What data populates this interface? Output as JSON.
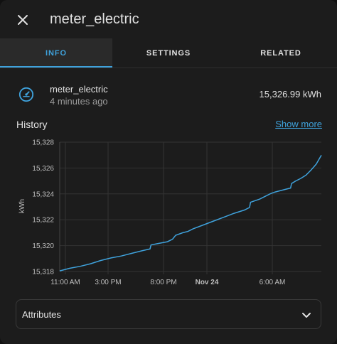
{
  "dialog": {
    "title": "meter_electric"
  },
  "tabs": [
    {
      "label": "INFO",
      "active": true
    },
    {
      "label": "SETTINGS",
      "active": false
    },
    {
      "label": "RELATED",
      "active": false
    }
  ],
  "entity": {
    "name": "meter_electric",
    "last_changed": "4 minutes ago",
    "state": "15,326.99 kWh",
    "icon": "gauge-icon"
  },
  "history": {
    "title": "History",
    "show_more": "Show more"
  },
  "chart_data": {
    "type": "line",
    "ylabel": "kWh",
    "xlabel": "",
    "ylim": [
      15318,
      15328
    ],
    "yticks": [
      15318,
      15320,
      15322,
      15324,
      15326,
      15328
    ],
    "ytick_labels": [
      "15,318",
      "15,320",
      "15,322",
      "15,324",
      "15,326",
      "15,328"
    ],
    "x_range": [
      0,
      24
    ],
    "xticks": [
      0,
      4,
      9,
      13,
      19
    ],
    "xtick_labels": [
      "11:00 AM",
      "3:00 PM",
      "8:00 PM",
      "Nov 24",
      "6:00 AM"
    ],
    "xtick_bold": [
      false,
      false,
      false,
      true,
      false
    ],
    "grid": true,
    "series": [
      {
        "color": "#3fa2dc",
        "points": [
          [
            0.0,
            15318.05
          ],
          [
            1.0,
            15318.25
          ],
          [
            2.0,
            15318.4
          ],
          [
            3.0,
            15318.6
          ],
          [
            4.0,
            15318.85
          ],
          [
            5.0,
            15319.05
          ],
          [
            6.0,
            15319.2
          ],
          [
            7.0,
            15319.4
          ],
          [
            8.0,
            15319.6
          ],
          [
            8.8,
            15319.75
          ],
          [
            8.9,
            15320.05
          ],
          [
            9.5,
            15320.15
          ],
          [
            10.5,
            15320.3
          ],
          [
            11.0,
            15320.5
          ],
          [
            11.3,
            15320.8
          ],
          [
            12.0,
            15321.0
          ],
          [
            12.5,
            15321.1
          ],
          [
            13.0,
            15321.3
          ],
          [
            14.0,
            15321.6
          ],
          [
            15.0,
            15321.9
          ],
          [
            16.0,
            15322.2
          ],
          [
            17.0,
            15322.5
          ],
          [
            18.0,
            15322.75
          ],
          [
            18.5,
            15322.95
          ],
          [
            18.6,
            15323.35
          ],
          [
            19.5,
            15323.6
          ],
          [
            20.0,
            15323.8
          ],
          [
            20.5,
            15324.0
          ],
          [
            21.0,
            15324.15
          ],
          [
            22.0,
            15324.35
          ],
          [
            22.5,
            15324.45
          ],
          [
            22.6,
            15324.8
          ],
          [
            23.0,
            15325.0
          ],
          [
            23.5,
            15325.2
          ],
          [
            24.0,
            15325.45
          ],
          [
            24.5,
            15325.85
          ],
          [
            25.0,
            15326.3
          ],
          [
            25.5,
            15326.99
          ]
        ]
      }
    ]
  },
  "attributes": {
    "label": "Attributes"
  },
  "colors": {
    "accent": "#3fa2dc",
    "background": "#1c1c1c",
    "text": "#e1e1e1",
    "secondary_text": "#9a9a9a"
  }
}
